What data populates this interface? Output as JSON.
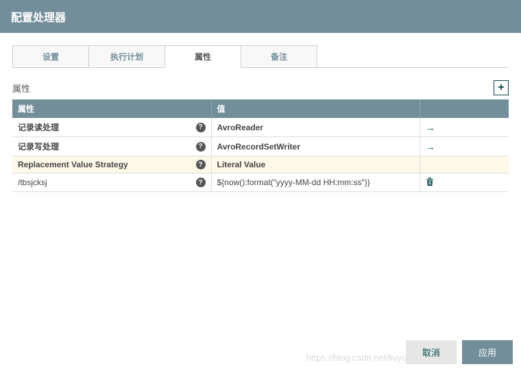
{
  "dialog": {
    "title": "配置处理器"
  },
  "tabs": {
    "items": [
      {
        "label": "设置"
      },
      {
        "label": "执行计划"
      },
      {
        "label": "属性"
      },
      {
        "label": "备注"
      }
    ]
  },
  "section": {
    "title": "属性"
  },
  "table": {
    "headers": {
      "name": "属性",
      "value": "值",
      "action": ""
    },
    "rows": [
      {
        "name": "记录读处理",
        "value": "AvroReader",
        "bold": false,
        "action": "goto"
      },
      {
        "name": "记录写处理",
        "value": "AvroRecordSetWriter",
        "bold": false,
        "action": "goto"
      },
      {
        "name": "Replacement Value Strategy",
        "value": "Literal Value",
        "bold": true,
        "highlight": true,
        "action": ""
      },
      {
        "name": "/tbsjcksj",
        "value": "${now():format(\"yyyy-MM-dd HH:mm:ss\")}",
        "bold": false,
        "action": "delete"
      }
    ]
  },
  "footer": {
    "cancel": "取消",
    "apply": "应用"
  },
  "watermark": "https://blog.csdn.net/liuyunshengsir"
}
